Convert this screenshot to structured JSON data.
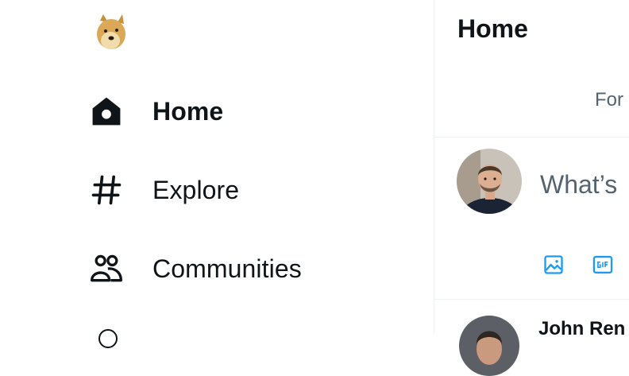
{
  "nav": {
    "logo_icon": "doge-logo-icon",
    "items": [
      {
        "label": "Home",
        "icon": "home-icon",
        "active": true
      },
      {
        "label": "Explore",
        "icon": "hashtag-icon",
        "active": false
      },
      {
        "label": "Communities",
        "icon": "communities-icon",
        "active": false
      }
    ]
  },
  "main": {
    "title": "Home",
    "tab_label": "For",
    "composer": {
      "placeholder": "What’s",
      "tools": [
        "image-icon",
        "gif-icon"
      ]
    },
    "tweet": {
      "author": "John Ren"
    }
  },
  "colors": {
    "accent": "#1d9bf0",
    "text": "#0f1419",
    "muted": "#536471",
    "border": "#eff3f4"
  }
}
